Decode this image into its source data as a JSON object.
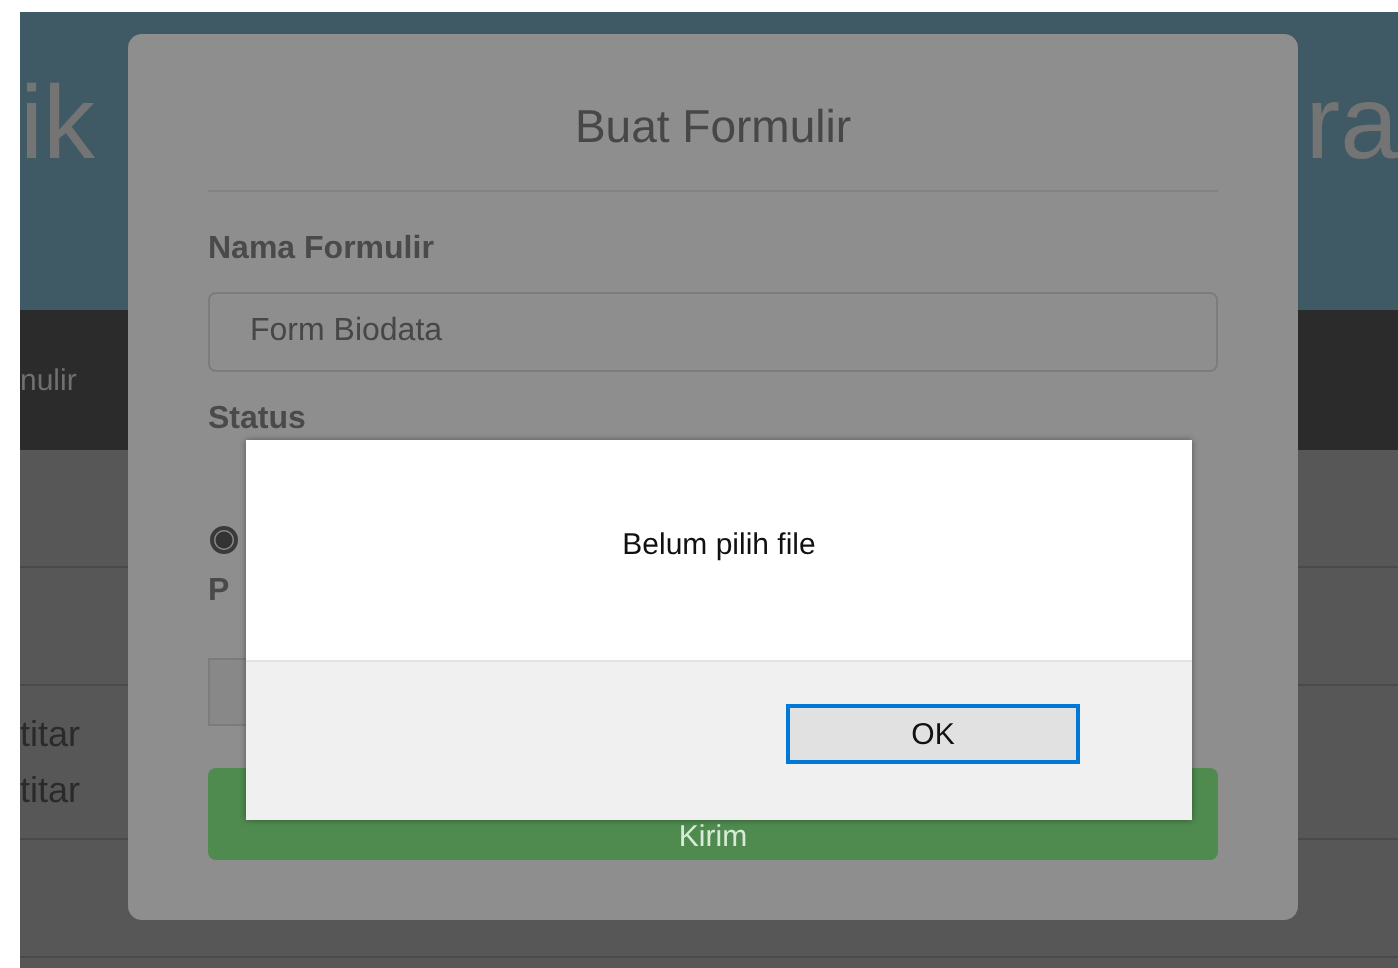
{
  "page": {
    "header_left": "ik",
    "header_right": "ra",
    "nav_item": "nulir",
    "list_items": [
      "titar",
      "titar"
    ]
  },
  "modal": {
    "title": "Buat Formulir",
    "name_field": {
      "label": "Nama Formulir",
      "value": "Form Biodata"
    },
    "status": {
      "label": "Status",
      "options": [
        {
          "selected": true
        }
      ]
    },
    "file_field": {
      "label": "P"
    },
    "submit": "Kirim"
  },
  "alert": {
    "message": "Belum pilih file",
    "buttons": [
      {
        "label": "OK",
        "focused": true
      }
    ]
  }
}
